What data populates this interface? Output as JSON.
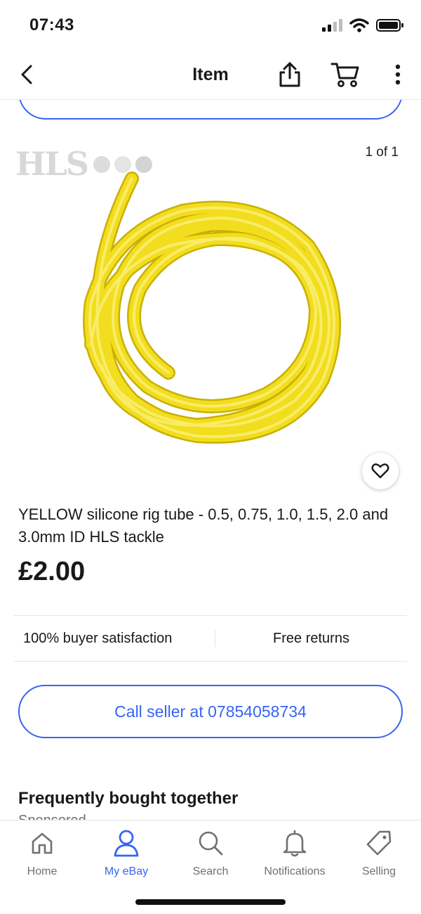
{
  "status_bar": {
    "time": "07:43"
  },
  "nav": {
    "title": "Item"
  },
  "gallery": {
    "watermark": "HLS",
    "counter": "1 of 1"
  },
  "item": {
    "title": "YELLOW silicone rig tube - 0.5, 0.75, 1.0, 1.5, 2.0 and 3.0mm ID HLS tackle",
    "price": "£2.00"
  },
  "features": {
    "satisfaction": "100% buyer satisfaction",
    "returns": "Free returns"
  },
  "call_seller": {
    "label": "Call seller at 07854058734"
  },
  "section": {
    "title": "Frequently bought together",
    "subtitle": "Sponsored"
  },
  "tabs": [
    {
      "label": "Home",
      "icon": "home-icon"
    },
    {
      "label": "My eBay",
      "icon": "user-icon",
      "active": true
    },
    {
      "label": "Search",
      "icon": "search-icon"
    },
    {
      "label": "Notifications",
      "icon": "bell-icon"
    },
    {
      "label": "Selling",
      "icon": "tag-icon"
    }
  ],
  "colors": {
    "accent": "#3665f3",
    "text": "#191919",
    "muted": "#707070",
    "tube": "#f2dd1e"
  }
}
